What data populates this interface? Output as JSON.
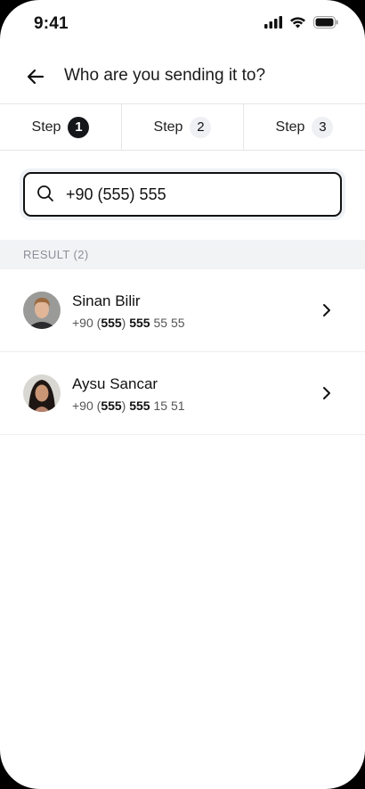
{
  "status": {
    "time": "9:41"
  },
  "header": {
    "title": "Who are you sending it to?"
  },
  "steps": [
    {
      "label": "Step",
      "num": "1"
    },
    {
      "label": "Step",
      "num": "2"
    },
    {
      "label": "Step",
      "num": "3"
    }
  ],
  "search": {
    "value": "+90 (555) 555"
  },
  "results": {
    "label": "RESULT (2)",
    "items": [
      {
        "name": "Sinan Bilir",
        "prefix": "+90 (",
        "area": "555",
        "mid": ") ",
        "match": "555",
        "rest": " 55 55"
      },
      {
        "name": "Aysu Sancar",
        "prefix": "+90 (",
        "area": "555",
        "mid": ") ",
        "match": "555",
        "rest": " 15 51"
      }
    ]
  },
  "icons": {
    "back": "arrow-left-icon",
    "search": "search-icon",
    "chevron": "chevron-right-icon"
  },
  "colors": {
    "active_step": "#15161a",
    "border": "#111111"
  }
}
